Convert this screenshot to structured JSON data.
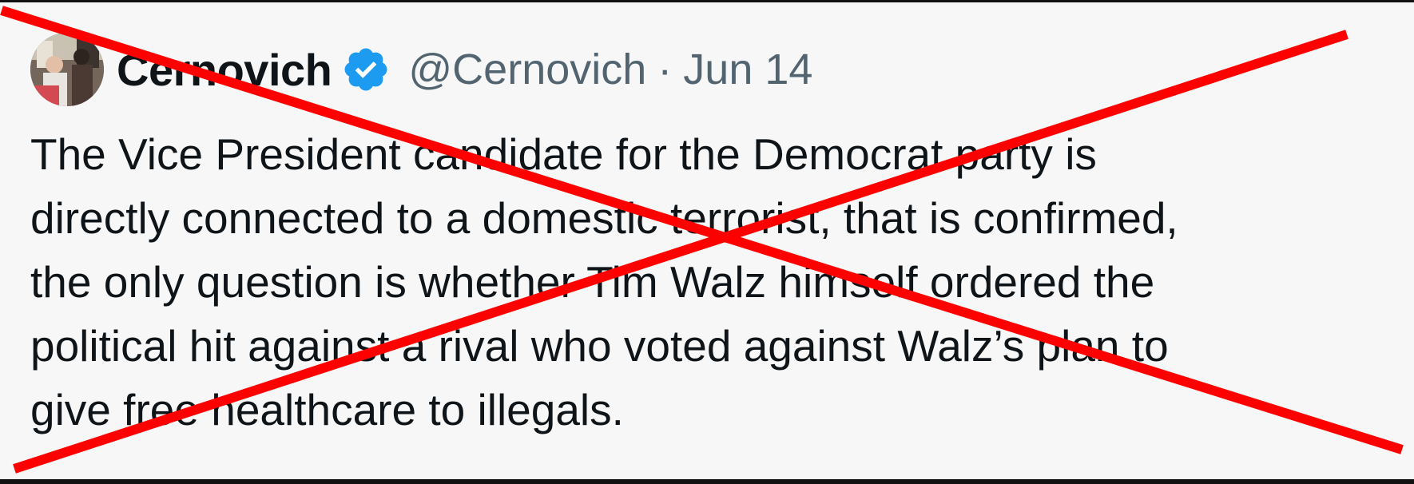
{
  "tweet": {
    "display_name": "Cernovich",
    "handle": "@Cernovich",
    "separator": "·",
    "date": "Jun 14",
    "text_lines": [
      "The Vice President candidate for the Democrat party is",
      "directly connected to a domestic terrorist, that is confirmed,",
      "the only question is whether Tim Walz himself ordered the",
      "political hit against a rival who voted against Walz’s plan to",
      "give free healthcare to illegals."
    ]
  },
  "icons": {
    "avatar": "profile-photo",
    "verified": "verified-badge-icon"
  },
  "overlay": {
    "mark": "red-x-cross",
    "color": "#ff0000"
  },
  "colors": {
    "verified_blue": "#1d9bf0",
    "text": "#0f1419",
    "secondary_text": "#536471",
    "background": "#f7f7f7"
  }
}
